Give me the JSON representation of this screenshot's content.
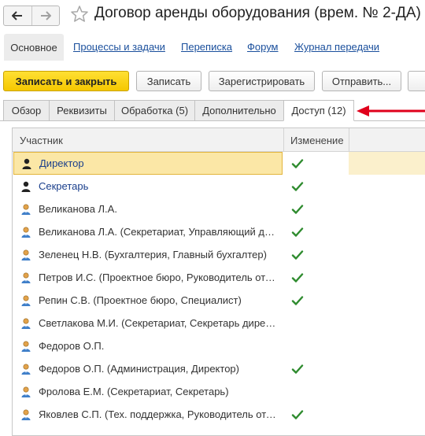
{
  "window": {
    "title": "Договор аренды оборудования (врем. № 2-ДА)"
  },
  "sections": {
    "main": "Основное",
    "links": [
      "Процессы и задачи",
      "Переписка",
      "Форум",
      "Журнал передачи"
    ]
  },
  "toolbar": {
    "save_close": "Записать и закрыть",
    "save": "Записать",
    "register": "Зарегистрировать",
    "send": "Отправить..."
  },
  "tabs": [
    "Обзор",
    "Реквизиты",
    "Обработка (5)",
    "Дополнительно",
    "Доступ (12)"
  ],
  "active_tab": "Доступ (12)",
  "table": {
    "columns": [
      "Участник",
      "Изменение"
    ],
    "rows": [
      {
        "name": "Директор",
        "kind": "role",
        "change": true,
        "selected": true
      },
      {
        "name": "Секретарь",
        "kind": "role",
        "change": true
      },
      {
        "name": "Великанова Л.А.",
        "kind": "user",
        "change": true
      },
      {
        "name": "Великанова Л.А. (Секретариат, Управляющий делами)",
        "kind": "user",
        "change": true
      },
      {
        "name": "Зеленец Н.В. (Бухгалтерия, Главный бухгалтер)",
        "kind": "user",
        "change": true
      },
      {
        "name": "Петров И.С. (Проектное бюро, Руководитель отдела)",
        "kind": "user",
        "change": true
      },
      {
        "name": "Репин С.В. (Проектное бюро, Специалист)",
        "kind": "user",
        "change": true
      },
      {
        "name": "Светлакова М.И. (Секретариат, Секретарь директора)",
        "kind": "user",
        "change": false
      },
      {
        "name": "Федоров О.П.",
        "kind": "user",
        "change": false
      },
      {
        "name": "Федоров О.П. (Администрация, Директор)",
        "kind": "user",
        "change": true
      },
      {
        "name": "Фролова Е.М. (Секретариат, Секретарь)",
        "kind": "user",
        "change": false
      },
      {
        "name": "Яковлев С.П. (Тех. поддержка, Руководитель отдела)",
        "kind": "user",
        "change": true
      }
    ]
  },
  "icons": {
    "back": "back-arrow-icon",
    "forward": "forward-arrow-icon",
    "favorite": "star-icon",
    "role": "role-user-icon",
    "user": "user-icon",
    "change": "check-icon",
    "pointer": "red-arrow-icon"
  },
  "colors": {
    "primary_button": "#f5c800",
    "link": "#1a4f9c",
    "selected_row": "#fbe7a6",
    "check": "#2e8b2e",
    "pointer_arrow": "#e0001b"
  }
}
